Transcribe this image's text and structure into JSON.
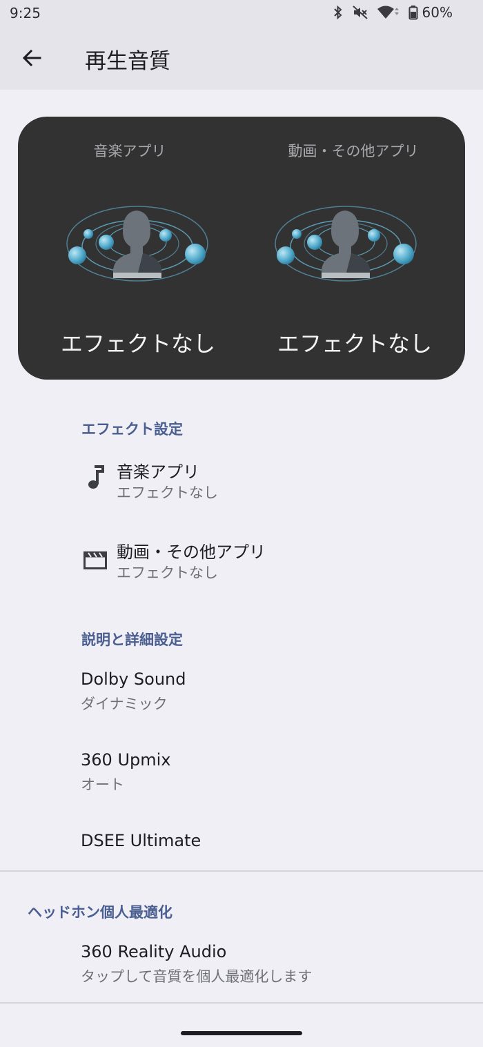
{
  "status_bar": {
    "time": "9:25",
    "battery": "60%",
    "icons": [
      "bluetooth-icon",
      "mute-icon",
      "wifi-icon",
      "battery-icon"
    ]
  },
  "app_bar": {
    "title": "再生音質",
    "back_icon": "arrow-back-icon"
  },
  "effect_card": {
    "music": {
      "title": "音楽アプリ",
      "value": "エフェクトなし"
    },
    "video": {
      "title": "動画・その他アプリ",
      "value": "エフェクトなし"
    }
  },
  "effect_settings": {
    "header": "エフェクト設定",
    "items": [
      {
        "icon": "music-note-icon",
        "title": "音楽アプリ",
        "subtitle": "エフェクトなし"
      },
      {
        "icon": "clapperboard-icon",
        "title": "動画・その他アプリ",
        "subtitle": "エフェクトなし"
      }
    ]
  },
  "details": {
    "header": "説明と詳細設定",
    "items": [
      {
        "title": "Dolby Sound",
        "subtitle": "ダイナミック"
      },
      {
        "title": "360 Upmix",
        "subtitle": "オート"
      },
      {
        "title": "DSEE Ultimate"
      }
    ]
  },
  "headphone": {
    "header": "ヘッドホン個人最適化",
    "items": [
      {
        "title": "360 Reality Audio",
        "subtitle": "タップして音質を個人最適化します"
      }
    ]
  },
  "colors": {
    "background": "#efeff5",
    "app_bar": "#e4e4ea",
    "card": "#323232",
    "section_header": "#4a5e91",
    "sphere": "#5fb4d3"
  }
}
